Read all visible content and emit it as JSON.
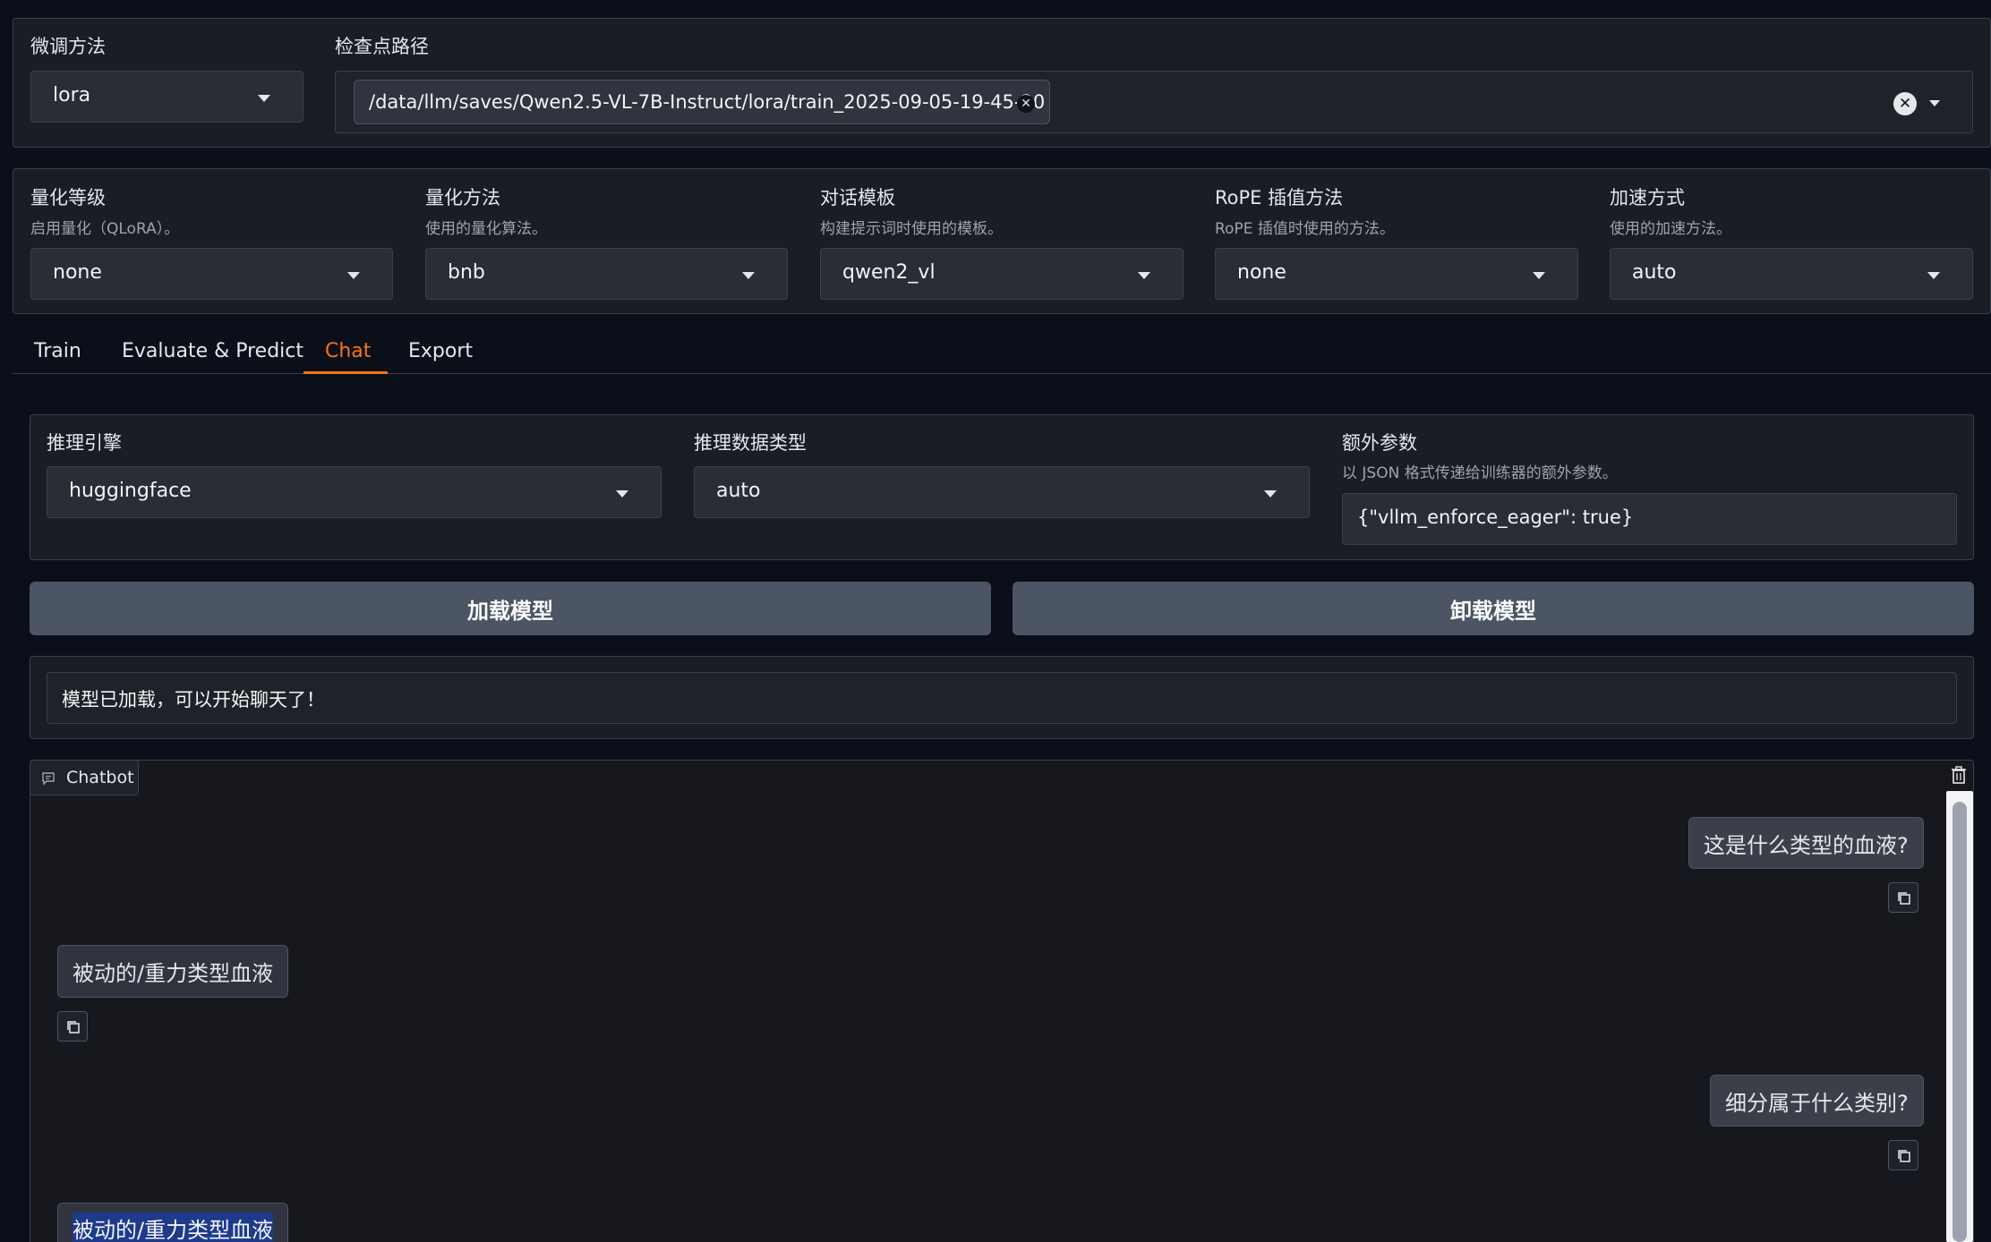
{
  "finetune": {
    "method_label": "微调方法",
    "method_value": "lora",
    "checkpoint_label": "检查点路径",
    "checkpoint_value": "/data/llm/saves/Qwen2.5-VL-7B-Instruct/lora/train_2025-09-05-19-45-20"
  },
  "options": [
    {
      "label": "量化等级",
      "hint": "启用量化（QLoRA）。",
      "value": "none"
    },
    {
      "label": "量化方法",
      "hint": "使用的量化算法。",
      "value": "bnb"
    },
    {
      "label": "对话模板",
      "hint": "构建提示词时使用的模板。",
      "value": "qwen2_vl"
    },
    {
      "label": "RoPE 插值方法",
      "hint": "RoPE 插值时使用的方法。",
      "value": "none"
    },
    {
      "label": "加速方式",
      "hint": "使用的加速方法。",
      "value": "auto"
    }
  ],
  "tabs": [
    {
      "label": "Train"
    },
    {
      "label": "Evaluate & Predict"
    },
    {
      "label": "Chat"
    },
    {
      "label": "Export"
    }
  ],
  "active_tab": "Chat",
  "colors": {
    "accent": "#f97316",
    "background": "#0b0f19",
    "panel": "#1f2937"
  },
  "chat": {
    "engine_label": "推理引擎",
    "engine_value": "huggingface",
    "dtype_label": "推理数据类型",
    "dtype_value": "auto",
    "extra_label": "额外参数",
    "extra_hint": "以 JSON 格式传递给训练器的额外参数。",
    "extra_value": "{\"vllm_enforce_eager\": true}",
    "load_button": "加载模型",
    "unload_button": "卸载模型",
    "status": "模型已加载，可以开始聊天了！",
    "chatbot_label": "Chatbot",
    "messages": [
      {
        "role": "user",
        "text": "这是什么类型的血液?"
      },
      {
        "role": "assistant",
        "text": "被动的/重力类型血液"
      },
      {
        "role": "user",
        "text": "细分属于什么类别?"
      },
      {
        "role": "assistant",
        "text": "被动的/重力类型血液"
      }
    ]
  }
}
